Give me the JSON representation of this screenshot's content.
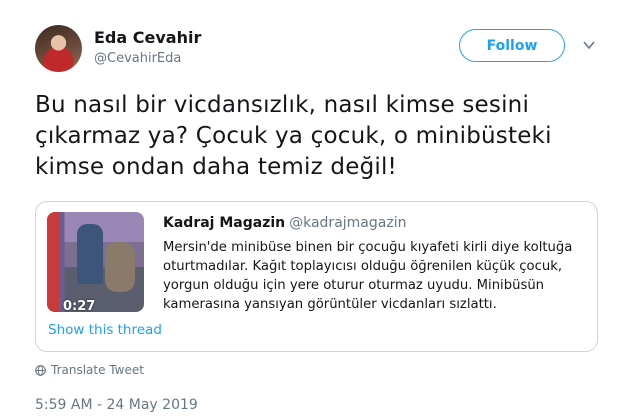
{
  "author": {
    "name": "Eda Cevahir",
    "handle": "@CevahirEda"
  },
  "follow_button": {
    "label": "Follow"
  },
  "tweet": {
    "lines": [
      "Bu nasıl bir vicdansızlık, nasıl kimse sesini",
      "çıkarmaz ya? Çocuk ya çocuk, o minibüsteki",
      "kimse ondan daha temiz değil!"
    ]
  },
  "quoted_tweet": {
    "name": "Kadraj Magazin",
    "handle": "@kadrajmagazin",
    "video_duration": "0:27",
    "lines": [
      "Mersin'de minibüse binen bir çocuğu kıyafeti kirli diye koltuğa",
      "oturtmadılar. Kağıt toplayıcısı olduğu öğrenilen küçük çocuk,",
      "yorgun olduğu için yere oturur oturmaz uyudu. Minibüsün",
      "kamerasına yansıyan görüntüler vicdanları sızlattı."
    ],
    "show_thread": "Show this thread"
  },
  "translate": {
    "label": "Translate Tweet",
    "icon": "globe-icon"
  },
  "timestamp": "5:59 AM - 24 May 2019",
  "colors": {
    "accent": "#1da1f2",
    "secondary_text": "#657786",
    "border": "#ccd6dd"
  }
}
